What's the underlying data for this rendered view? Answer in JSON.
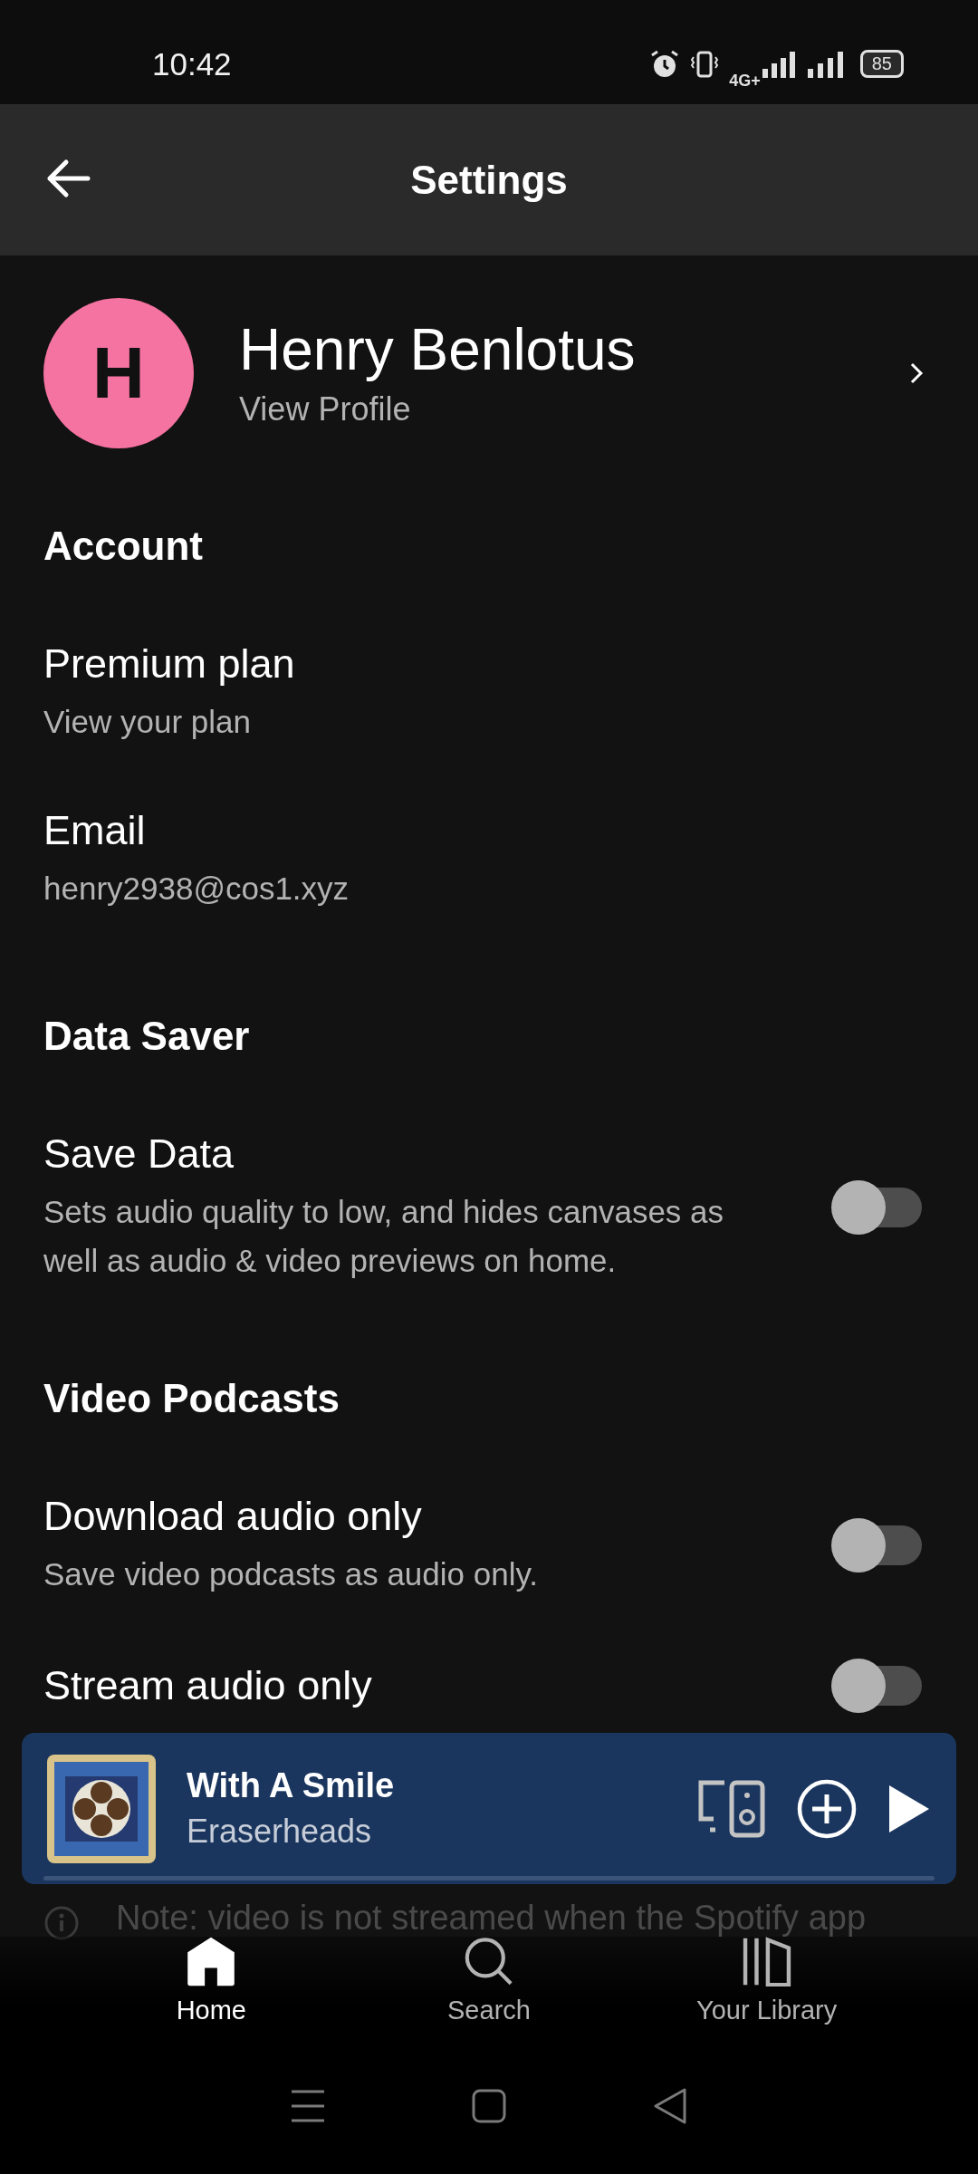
{
  "status_bar": {
    "time": "10:42",
    "network": "4G+",
    "battery": "85"
  },
  "header": {
    "title": "Settings"
  },
  "profile": {
    "initial": "H",
    "name": "Henry Benlotus",
    "link": "View Profile"
  },
  "sections": [
    {
      "heading": "Account",
      "items": [
        {
          "kind": "link",
          "title": "Premium plan",
          "subtitle": "View your plan"
        },
        {
          "kind": "info",
          "title": "Email",
          "subtitle": "henry2938@cos1.xyz"
        }
      ]
    },
    {
      "heading": "Data Saver",
      "items": [
        {
          "kind": "toggle",
          "title": "Save Data",
          "subtitle": "Sets audio quality to low, and hides canvases as well as audio & video previews on home.",
          "on": false
        }
      ]
    },
    {
      "heading": "Video Podcasts",
      "items": [
        {
          "kind": "toggle",
          "title": "Download audio only",
          "subtitle": "Save video podcasts as audio only.",
          "on": false
        },
        {
          "kind": "toggle",
          "title": "Stream audio only",
          "on": false
        }
      ]
    }
  ],
  "note": "Note: video is not streamed when the Spotify app",
  "now_playing": {
    "title": "With A Smile",
    "artist": "Eraserheads"
  },
  "tabs": [
    {
      "label": "Home",
      "selected": true,
      "kind": "home"
    },
    {
      "label": "Search",
      "selected": false,
      "kind": "search"
    },
    {
      "label": "Your Library",
      "selected": false,
      "kind": "library"
    }
  ]
}
